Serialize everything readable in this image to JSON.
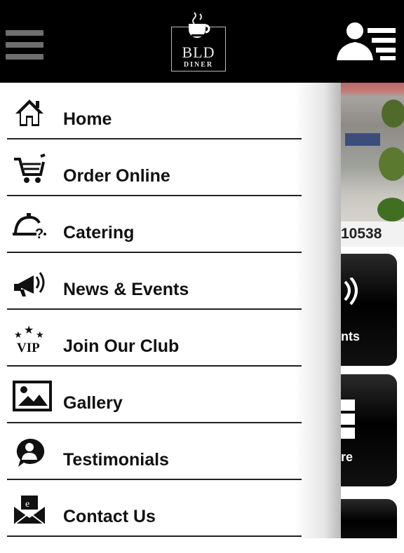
{
  "header": {
    "menu_icon": "hamburger-icon",
    "logo_text": "BLD",
    "logo_subtext": "DINER",
    "user_icon": "user-menu-icon"
  },
  "menu": {
    "items": [
      {
        "label": "Home",
        "icon": "home-icon"
      },
      {
        "label": "Order Online",
        "icon": "cart-icon"
      },
      {
        "label": "Catering",
        "icon": "catering-icon"
      },
      {
        "label": "News & Events",
        "icon": "megaphone-icon"
      },
      {
        "label": "Join Our Club",
        "icon": "vip-icon"
      },
      {
        "label": "Gallery",
        "icon": "gallery-icon"
      },
      {
        "label": "Testimonials",
        "icon": "testimonial-icon"
      },
      {
        "label": "Contact Us",
        "icon": "contact-icon"
      }
    ]
  },
  "background": {
    "phone_fragment": "10538",
    "tile1_label": "nts",
    "tile2_label": "re"
  }
}
